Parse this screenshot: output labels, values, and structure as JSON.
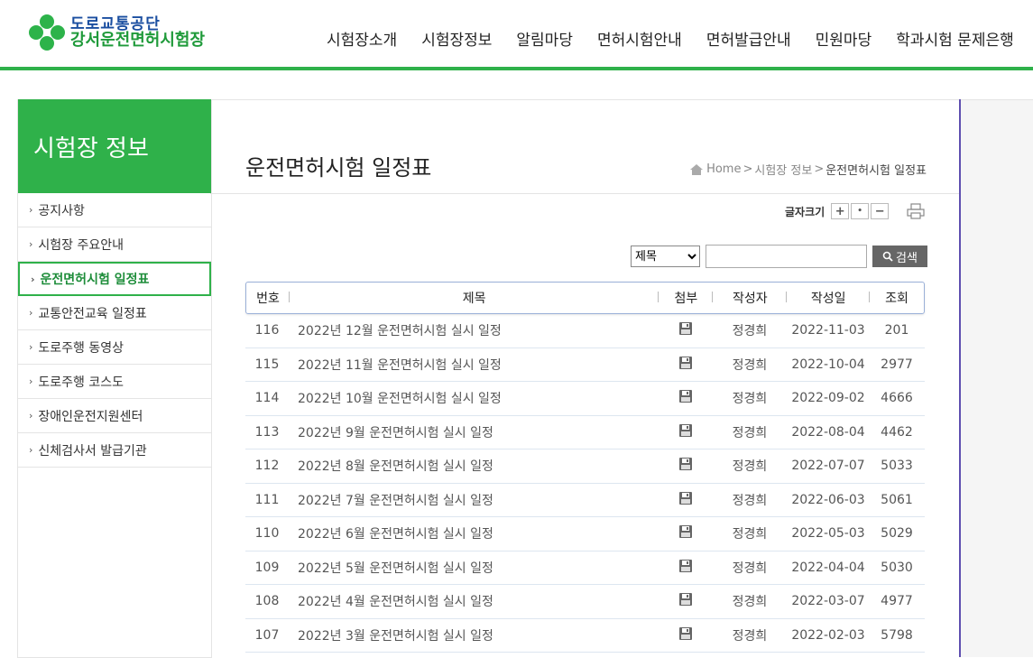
{
  "logo": {
    "line1": "도로교통공단",
    "line2": "강서운전면허시험장"
  },
  "gnb": [
    "시험장소개",
    "시험장정보",
    "알림마당",
    "면허시험안내",
    "면허발급안내",
    "민원마당",
    "학과시험 문제은행"
  ],
  "lnb": {
    "title": "시험장 정보",
    "items": [
      {
        "label": "공지사항"
      },
      {
        "label": "시험장 주요안내"
      },
      {
        "label": "운전면허시험 일정표"
      },
      {
        "label": "교통안전교육 일정표"
      },
      {
        "label": "도로주행 동영상"
      },
      {
        "label": "도로주행 코스도"
      },
      {
        "label": "장애인운전지원센터"
      },
      {
        "label": "신체검사서 발급기관"
      }
    ]
  },
  "page": {
    "title": "운전면허시험 일정표",
    "breadcrumb": {
      "home": "Home",
      "sep": ">",
      "level1": "시험장 정보",
      "current": "운전면허시험 일정표"
    }
  },
  "fontsize": {
    "label": "글자크기",
    "plus": "+",
    "reset": "•",
    "minus": "−"
  },
  "search": {
    "option": "제목",
    "button": "검색",
    "placeholder": ""
  },
  "table": {
    "headers": {
      "num": "번호",
      "title": "제목",
      "file": "첨부",
      "writer": "작성자",
      "date": "작성일",
      "views": "조회"
    },
    "rows": [
      {
        "num": "116",
        "title": "2022년 12월 운전면허시험 실시 일정",
        "writer": "정경희",
        "date": "2022-11-03",
        "views": "201"
      },
      {
        "num": "115",
        "title": "2022년 11월 운전면허시험 실시 일정",
        "writer": "정경희",
        "date": "2022-10-04",
        "views": "2977"
      },
      {
        "num": "114",
        "title": "2022년 10월 운전면허시험 실시 일정",
        "writer": "정경희",
        "date": "2022-09-02",
        "views": "4666"
      },
      {
        "num": "113",
        "title": "2022년 9월 운전면허시험 실시 일정",
        "writer": "정경희",
        "date": "2022-08-04",
        "views": "4462"
      },
      {
        "num": "112",
        "title": "2022년 8월 운전면허시험 실시 일정",
        "writer": "정경희",
        "date": "2022-07-07",
        "views": "5033"
      },
      {
        "num": "111",
        "title": "2022년 7월 운전면허시험 실시 일정",
        "writer": "정경희",
        "date": "2022-06-03",
        "views": "5061"
      },
      {
        "num": "110",
        "title": "2022년 6월 운전면허시험 실시 일정",
        "writer": "정경희",
        "date": "2022-05-03",
        "views": "5029"
      },
      {
        "num": "109",
        "title": "2022년 5월 운전면허시험 실시 일정",
        "writer": "정경희",
        "date": "2022-04-04",
        "views": "5030"
      },
      {
        "num": "108",
        "title": "2022년 4월 운전면허시험 실시 일정",
        "writer": "정경희",
        "date": "2022-03-07",
        "views": "4977"
      },
      {
        "num": "107",
        "title": "2022년 3월 운전면허시험 실시 일정",
        "writer": "정경희",
        "date": "2022-02-03",
        "views": "5798"
      }
    ]
  },
  "colors": {
    "brand_green": "#2fb14a",
    "brand_blue": "#1a4ea0",
    "accent_purple": "#5f4fb0"
  },
  "icons": {
    "attachment": "floppy-disk-icon",
    "home": "home-icon",
    "print": "print-icon",
    "search": "search-icon"
  }
}
